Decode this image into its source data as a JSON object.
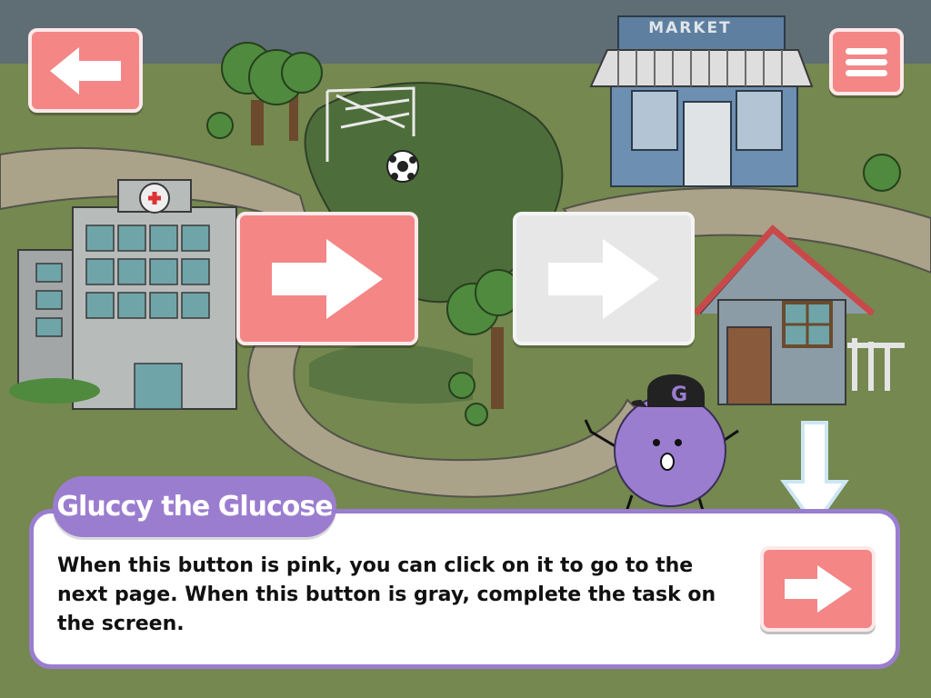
{
  "scene": {
    "market_sign": "MARKET",
    "cap_letter": "G"
  },
  "dialog": {
    "speaker": "Gluccy the Glucose",
    "text": "When this button is pink, you can click on it to go to the next page. When this button is gray, complete the task on the screen."
  },
  "colors": {
    "button_pink": "#f48686",
    "button_gray": "#e7e7e7",
    "dialog_border": "#9b7dd0",
    "character": "#9b7dd0",
    "ground": "#74884f"
  },
  "icons": {
    "back": "arrow-left-icon",
    "menu": "hamburger-menu-icon",
    "next": "arrow-right-icon",
    "hint": "arrow-down-icon"
  }
}
